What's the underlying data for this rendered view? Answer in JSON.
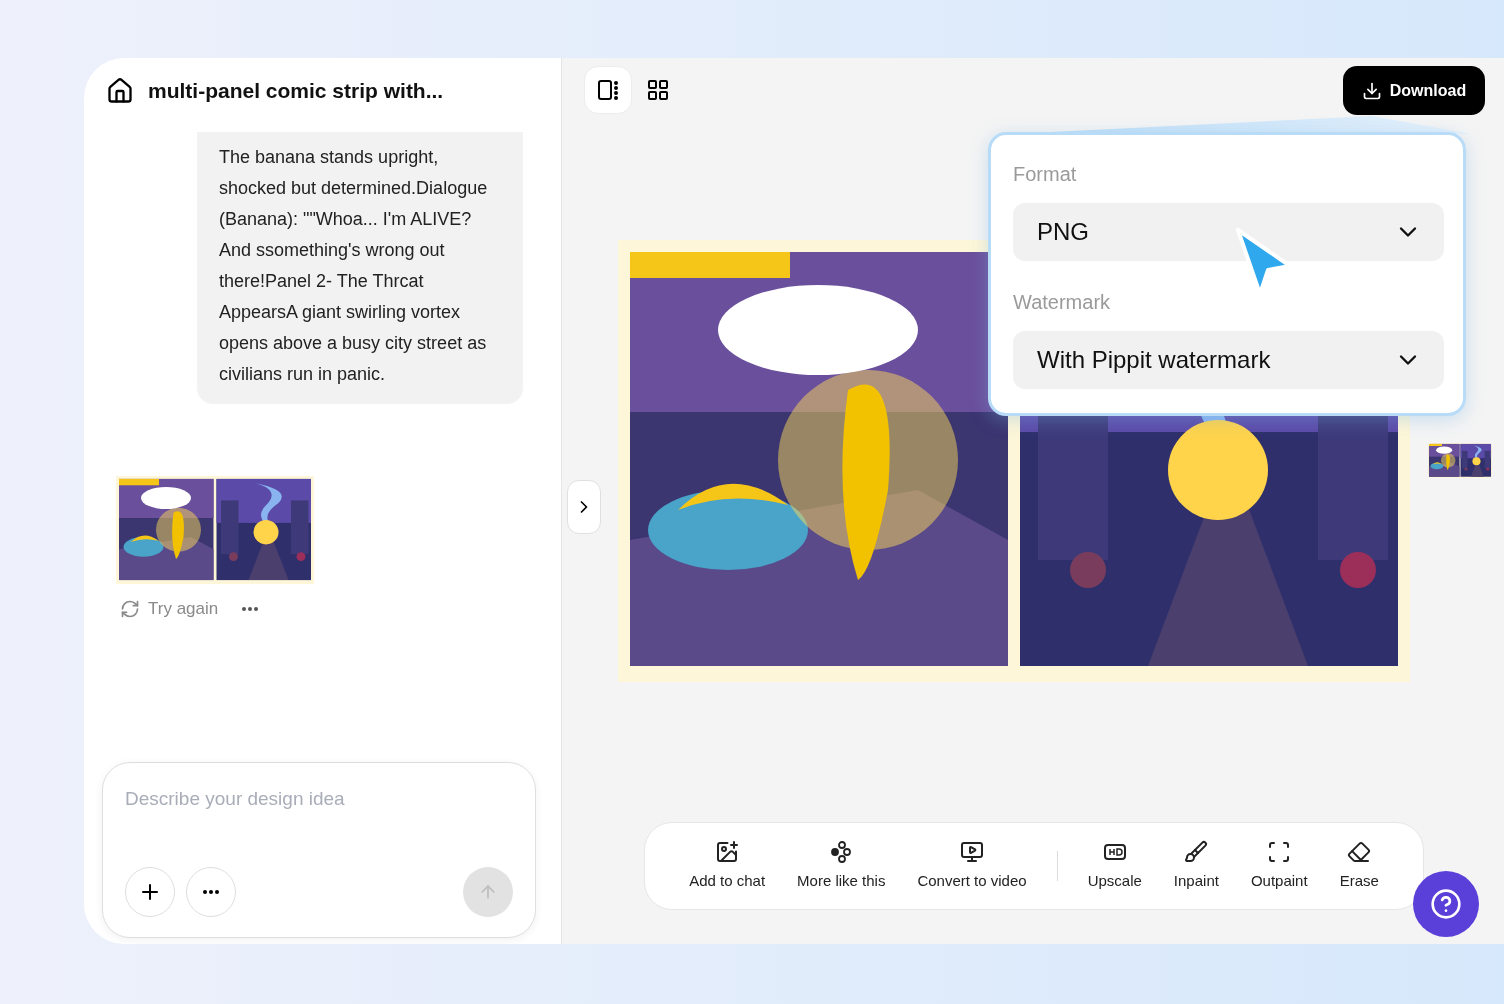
{
  "header": {
    "title": "multi-panel comic strip with..."
  },
  "chat": {
    "message": "The banana stands upright, shocked but determined.Dialogue (Banana): \"\"Whoa... I'm ALIVE? And ssomething's wrong out there!Panel 2- The Thrcat AppearsA giant swirling vortex opens above a busy city street as civilians run in panic.",
    "retry": "Try again"
  },
  "composer": {
    "placeholder": "Describe your design idea"
  },
  "download_button": "Download",
  "export_panel": {
    "fields": [
      {
        "label": "Format",
        "value": "PNG"
      },
      {
        "label": "Watermark",
        "value": "With Pippit watermark"
      }
    ]
  },
  "toolbar": {
    "groups": [
      [
        {
          "kind": "chat",
          "label": "Add to chat"
        },
        {
          "kind": "similar",
          "label": "More like this"
        },
        {
          "kind": "video",
          "label": "Convert to video"
        }
      ],
      [
        {
          "kind": "upscale",
          "label": "Upscale"
        },
        {
          "kind": "inpaint",
          "label": "Inpaint"
        },
        {
          "kind": "outpaint",
          "label": "Outpaint"
        },
        {
          "kind": "erase",
          "label": "Erase"
        }
      ]
    ]
  }
}
